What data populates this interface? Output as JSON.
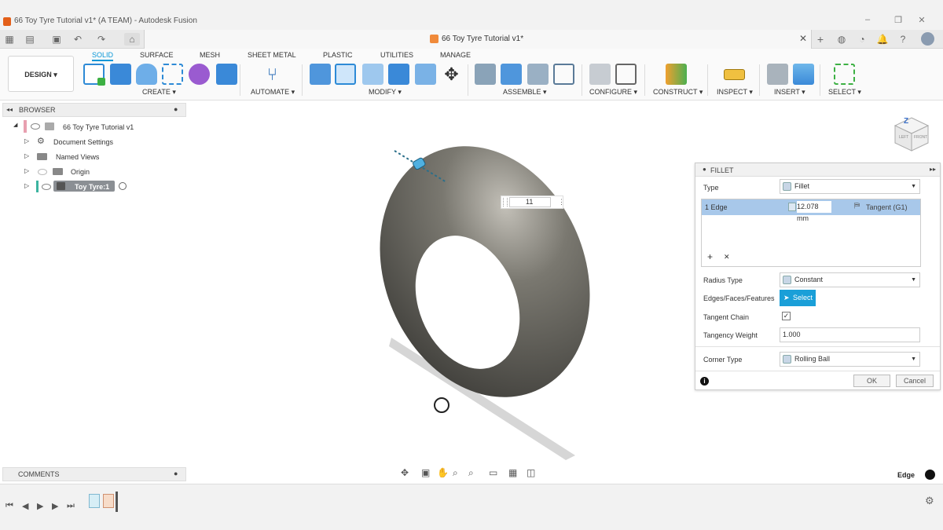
{
  "window": {
    "title": "66 Toy Tyre Tutorial v1* (A TEAM) - Autodesk Fusion",
    "minimize": "–",
    "maximize": "❐",
    "close": "✕"
  },
  "tab": {
    "title": "66 Toy Tyre Tutorial v1*",
    "close": "✕"
  },
  "workspace": {
    "label": "DESIGN ▾"
  },
  "ribbon_tabs": [
    "SOLID",
    "SURFACE",
    "MESH",
    "SHEET METAL",
    "PLASTIC",
    "UTILITIES",
    "MANAGE"
  ],
  "ribbon_groups": {
    "create": "CREATE ▾",
    "automate": "AUTOMATE ▾",
    "modify": "MODIFY ▾",
    "assemble": "ASSEMBLE ▾",
    "configure": "CONFIGURE ▾",
    "construct": "CONSTRUCT ▾",
    "inspect": "INSPECT ▾",
    "insert": "INSERT ▾",
    "select": "SELECT ▾"
  },
  "browser": {
    "header": "BROWSER",
    "root": "66 Toy Tyre Tutorial v1",
    "items": [
      "Document Settings",
      "Named Views",
      "Origin",
      "Toy Tyre:1"
    ]
  },
  "comments": {
    "header": "COMMENTS"
  },
  "viewport": {
    "input_value": "11",
    "status": "Edge",
    "viewcube": {
      "top": "TOP",
      "front": "FRONT",
      "left": "LEFT"
    }
  },
  "fillet": {
    "header": "FILLET",
    "type_label": "Type",
    "type_value": "Fillet",
    "edge_label": "1 Edge",
    "edge_radius": "12.078 mm",
    "edge_continuity": "Tangent (G1)",
    "add": "+",
    "remove": "✕",
    "radius_type_label": "Radius Type",
    "radius_type_value": "Constant",
    "edges_label": "Edges/Faces/Features",
    "select_btn": "Select",
    "tangent_chain_label": "Tangent Chain",
    "tangent_chain_checked": "✓",
    "tangency_weight_label": "Tangency Weight",
    "tangency_weight_value": "1.000",
    "corner_type_label": "Corner Type",
    "corner_type_value": "Rolling Ball",
    "ok": "OK",
    "cancel": "Cancel",
    "info": "i"
  },
  "colors": {
    "accent": "#0696d7",
    "select_bg": "#1a9fd8",
    "row_highlight": "#a8c8ea",
    "tyre": "#6b6a64"
  },
  "icons": [
    "app-grid-icon",
    "file-icon",
    "save-icon",
    "undo-icon",
    "redo-icon",
    "home-icon",
    "gear-icon",
    "folder-icon",
    "eye-icon",
    "cube-icon",
    "info-icon"
  ]
}
